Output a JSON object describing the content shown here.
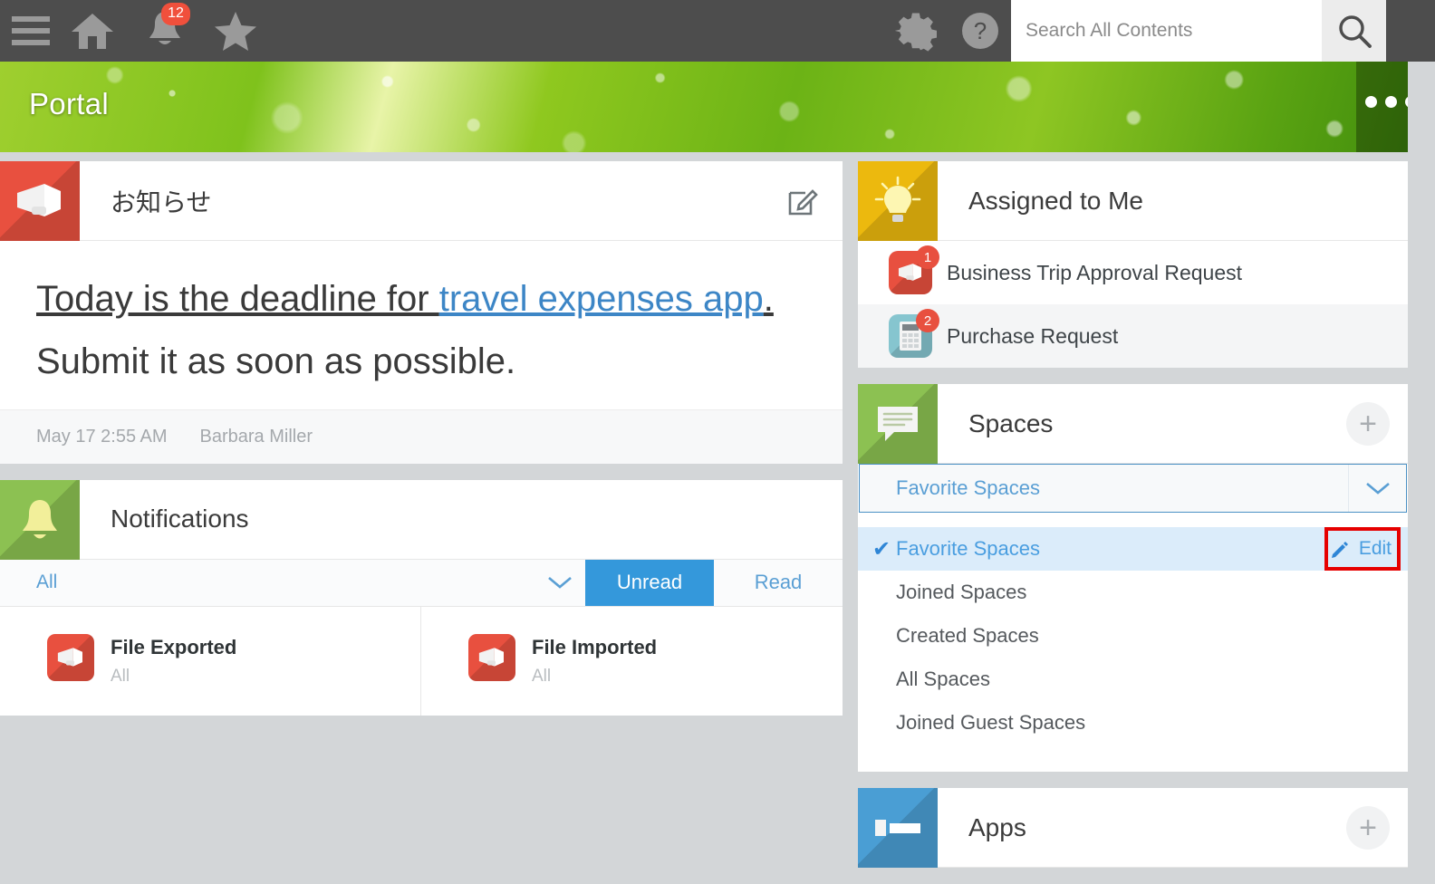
{
  "topbar": {
    "menu_icon": "hamburger-icon",
    "home_icon": "home-icon",
    "bell_icon": "bell-icon",
    "bell_badge": "12",
    "star_icon": "star-icon",
    "gear_icon": "gear-icon",
    "help_icon": "help-icon",
    "search_placeholder": "Search All Contents",
    "search_value": "",
    "search_icon": "search-icon"
  },
  "banner": {
    "title": "Portal",
    "more_icon": "more-options-icon"
  },
  "announcement": {
    "title": "お知らせ",
    "compose_icon": "compose-icon",
    "line1_prefix": "Today is the deadline for ",
    "line1_link": "travel expenses app",
    "line1_suffix": ".",
    "line2": "Submit it as soon as possible.",
    "date": "May 17 2:55 AM",
    "author": "Barbara Miller"
  },
  "notifications": {
    "title": "Notifications",
    "filter_all": "All",
    "chevron_icon": "chevron-down-icon",
    "tab_unread": "Unread",
    "tab_read": "Read",
    "active_tab": "Unread",
    "items": [
      {
        "title": "File Exported",
        "sub": "All",
        "icon": "megaphone-icon"
      },
      {
        "title": "File Imported",
        "sub": "All",
        "icon": "megaphone-icon"
      }
    ]
  },
  "assigned": {
    "title": "Assigned to Me",
    "icon": "lightbulb-icon",
    "items": [
      {
        "label": "Business Trip Approval Request",
        "badge": "1",
        "icon": "megaphone-icon"
      },
      {
        "label": "Purchase Request",
        "badge": "2",
        "icon": "calculator-icon"
      }
    ]
  },
  "spaces": {
    "title": "Spaces",
    "icon": "speech-bubble-icon",
    "add_icon": "plus-icon",
    "selected": "Favorite Spaces",
    "chevron_icon": "chevron-down-icon",
    "menu": [
      {
        "label": "Favorite Spaces",
        "selected": true,
        "edit_label": "Edit",
        "edit_icon": "pencil-icon"
      },
      {
        "label": "Joined Spaces",
        "selected": false
      },
      {
        "label": "Created Spaces",
        "selected": false
      },
      {
        "label": "All Spaces",
        "selected": false
      },
      {
        "label": "Joined Guest Spaces",
        "selected": false
      }
    ]
  },
  "apps": {
    "title": "Apps",
    "icon": "apps-icon",
    "add_icon": "plus-icon"
  },
  "colors": {
    "topbar": "#4d4d4d",
    "accent_blue": "#3498db",
    "link_blue": "#3d86c6",
    "badge_red": "#f0503c",
    "highlight_red": "#e60000",
    "page_bg": "#d3d6d8"
  }
}
